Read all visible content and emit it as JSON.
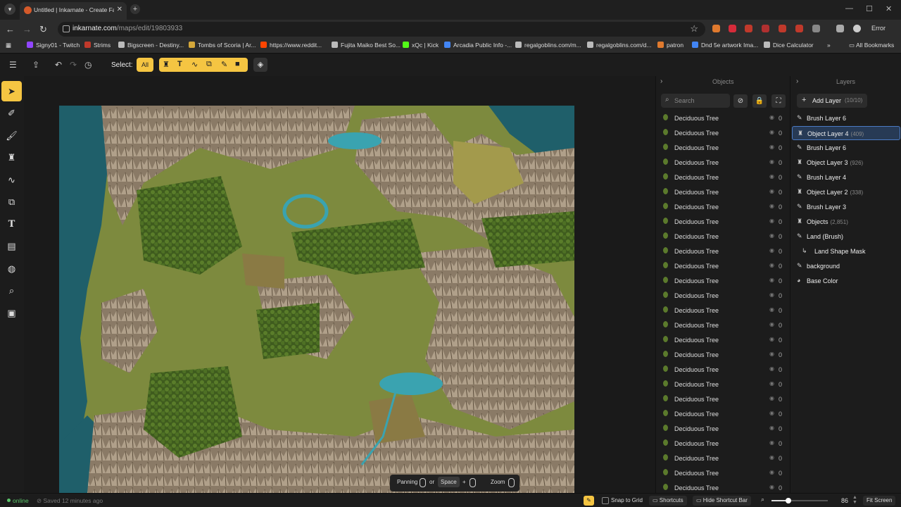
{
  "browser": {
    "tab_title": "Untitled | Inkarnate - Create Fa",
    "url_host": "inkarnate.com",
    "url_path": "/maps/edit/19803933",
    "error_label": "Error",
    "bookmarks": [
      {
        "label": "Signy01 - Twitch",
        "color": "#9146ff"
      },
      {
        "label": "Strims",
        "color": "#c0392b"
      },
      {
        "label": "Bigscreen - Destiny...",
        "color": "#bbbbbb"
      },
      {
        "label": "Tombs of Scoria | Ar...",
        "color": "#d4a73a"
      },
      {
        "label": "https://www.reddit...",
        "color": "#ff4500"
      },
      {
        "label": "Fujita Maiko Best So...",
        "color": "#bbbbbb"
      },
      {
        "label": "xQc | Kick",
        "color": "#53fc18"
      },
      {
        "label": "Arcadia Public Info -...",
        "color": "#4285f4"
      },
      {
        "label": "regalgoblins.com/m...",
        "color": "#bbbbbb"
      },
      {
        "label": "regalgoblins.com/d...",
        "color": "#bbbbbb"
      },
      {
        "label": "patron",
        "color": "#e07a2e"
      },
      {
        "label": "Dnd 5e artwork Ima...",
        "color": "#4285f4"
      },
      {
        "label": "Dice Calculator",
        "color": "#bbbbbb"
      }
    ],
    "all_bookmarks": "All Bookmarks"
  },
  "toolbar": {
    "select_label": "Select:",
    "all_label": "All"
  },
  "objects_panel": {
    "title": "Objects",
    "search_placeholder": "Search",
    "items": [
      {
        "name": "Deciduous Tree",
        "count": "0"
      },
      {
        "name": "Deciduous Tree",
        "count": "0"
      },
      {
        "name": "Deciduous Tree",
        "count": "0"
      },
      {
        "name": "Deciduous Tree",
        "count": "0"
      },
      {
        "name": "Deciduous Tree",
        "count": "0"
      },
      {
        "name": "Deciduous Tree",
        "count": "0"
      },
      {
        "name": "Deciduous Tree",
        "count": "0"
      },
      {
        "name": "Deciduous Tree",
        "count": "0"
      },
      {
        "name": "Deciduous Tree",
        "count": "0"
      },
      {
        "name": "Deciduous Tree",
        "count": "0"
      },
      {
        "name": "Deciduous Tree",
        "count": "0"
      },
      {
        "name": "Deciduous Tree",
        "count": "0"
      },
      {
        "name": "Deciduous Tree",
        "count": "0"
      },
      {
        "name": "Deciduous Tree",
        "count": "0"
      },
      {
        "name": "Deciduous Tree",
        "count": "0"
      },
      {
        "name": "Deciduous Tree",
        "count": "0"
      },
      {
        "name": "Deciduous Tree",
        "count": "0"
      },
      {
        "name": "Deciduous Tree",
        "count": "0"
      },
      {
        "name": "Deciduous Tree",
        "count": "0"
      },
      {
        "name": "Deciduous Tree",
        "count": "0"
      },
      {
        "name": "Deciduous Tree",
        "count": "0"
      },
      {
        "name": "Deciduous Tree",
        "count": "0"
      },
      {
        "name": "Deciduous Tree",
        "count": "0"
      },
      {
        "name": "Deciduous Tree",
        "count": "0"
      },
      {
        "name": "Deciduous Tree",
        "count": "0"
      },
      {
        "name": "Deciduous Tree",
        "count": "0"
      }
    ]
  },
  "layers_panel": {
    "title": "Layers",
    "add_label": "Add Layer",
    "add_count": "(10/10)",
    "items": [
      {
        "name": "Brush Layer 6",
        "count": "",
        "icon": "brush-icon",
        "active": false
      },
      {
        "name": "Object Layer 4",
        "count": "(409)",
        "icon": "tower-icon",
        "active": true
      },
      {
        "name": "Brush Layer 6",
        "count": "",
        "icon": "brush-icon",
        "active": false
      },
      {
        "name": "Object Layer 3",
        "count": "(926)",
        "icon": "tower-icon",
        "active": false
      },
      {
        "name": "Brush Layer 4",
        "count": "",
        "icon": "brush-icon",
        "active": false
      },
      {
        "name": "Object Layer 2",
        "count": "(338)",
        "icon": "tower-icon",
        "active": false
      },
      {
        "name": "Brush Layer 3",
        "count": "",
        "icon": "brush-icon",
        "active": false
      },
      {
        "name": "Objects",
        "count": "(2,851)",
        "icon": "tower-icon",
        "active": false
      },
      {
        "name": "Land (Brush)",
        "count": "",
        "icon": "brush-icon",
        "active": false
      },
      {
        "name": "Land Shape Mask",
        "count": "",
        "icon": "mask-icon",
        "active": false
      },
      {
        "name": "background",
        "count": "",
        "icon": "brush-icon",
        "active": false
      },
      {
        "name": "Base Color",
        "count": "",
        "icon": "palette-icon",
        "active": false
      }
    ]
  },
  "shortcut_bar": {
    "panning": "Panning",
    "or": "or",
    "space": "Space",
    "plus": "+",
    "zoom": "Zoom"
  },
  "status": {
    "online": "online",
    "saved": "Saved 12 minutes ago",
    "snap_to_grid": "Snap to Grid",
    "shortcuts": "Shortcuts",
    "hide_shortcut_bar": "Hide Shortcut Bar",
    "zoom_value": "86",
    "zoom_fraction": 0.3,
    "fit_screen": "Fit Screen"
  },
  "colors": {
    "accent": "#f5c542",
    "active_layer": "#273a55",
    "online": "#5bc46a"
  }
}
